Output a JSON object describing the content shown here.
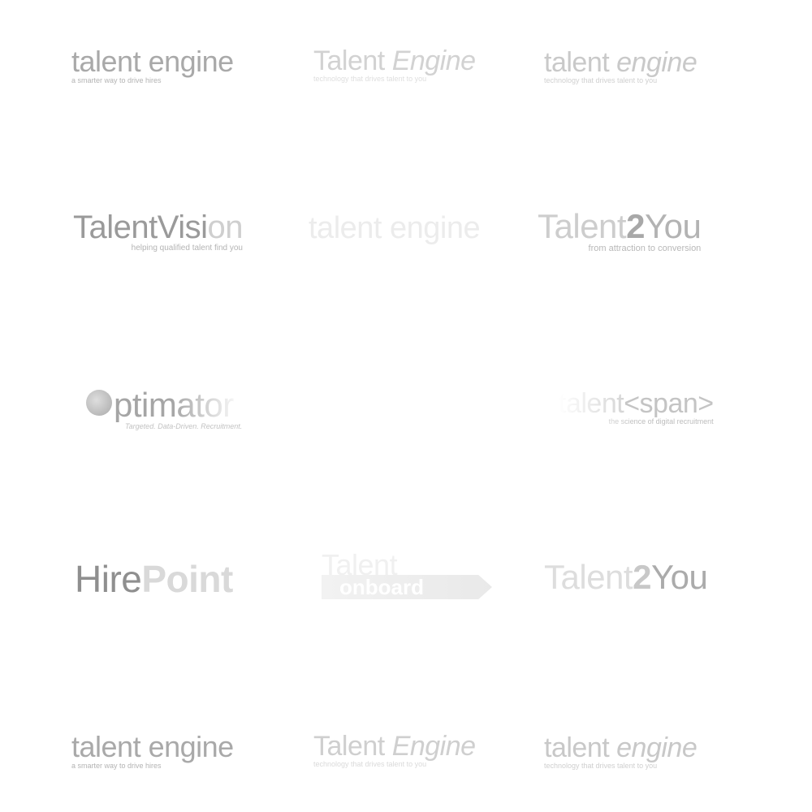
{
  "logos": [
    {
      "a": "talent ",
      "b": "engine",
      "tagline": "a smarter way to drive hires"
    },
    {
      "a": "Talent",
      "b": "Engine",
      "tagline": "technology that drives talent to you"
    },
    {
      "a": "talent ",
      "b": "engine",
      "tagline": "technology that drives talent to you"
    },
    {
      "a": "TalentVisi",
      "b": "on",
      "tagline": "helping qualified talent find you"
    },
    {
      "a": "talent engine"
    },
    {
      "a": "Talent",
      "b": "2",
      "c": "You",
      "tagline": "from attraction to conversion"
    },
    {
      "a": "ptimator",
      "tagline": "Targeted. Data-Driven. Recruitment."
    },
    {
      "a": "talent",
      "b": "<span>",
      "tagline": "the science of digital recruitment"
    },
    {
      "a": "Hire",
      "b": "Point"
    },
    {
      "a": "Talent",
      "b": "onboard"
    },
    {
      "a": "Talent",
      "b": "2",
      "c": "You"
    },
    {
      "a": "talent ",
      "b": "engine",
      "tagline": "a smarter way to drive hires"
    },
    {
      "a": "Talent",
      "b": "Engine",
      "tagline": "technology that drives talent to you"
    },
    {
      "a": "talent ",
      "b": "engine",
      "tagline": "technology that drives talent to you"
    }
  ]
}
